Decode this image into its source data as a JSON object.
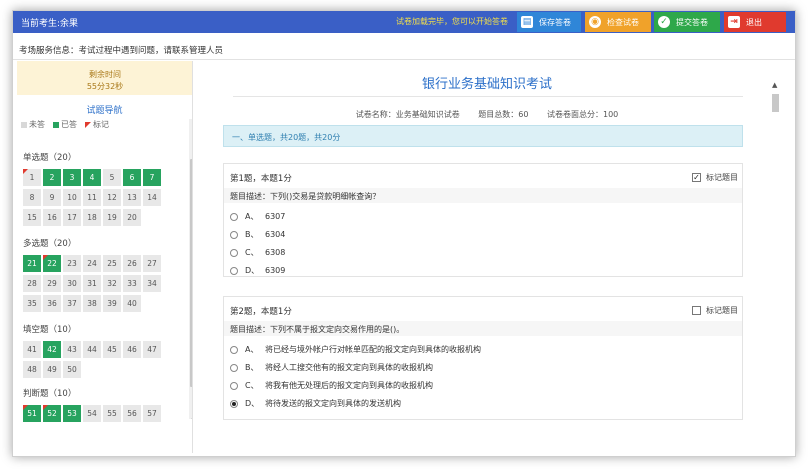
{
  "header": {
    "candidate": "当前考生:余果",
    "load_message": "试卷加载完毕，您可以开始答卷",
    "buttons": {
      "save": "保存答卷",
      "check": "检查试卷",
      "submit": "提交答卷",
      "exit": "退出"
    }
  },
  "notice": "考场服务信息：考试过程中遇到问题，请联系管理人员",
  "sidebar": {
    "timer_label": "剩余时间",
    "timer_value": "55分32秒",
    "nav_title": "试题导航",
    "legend": {
      "unanswered": "未答",
      "answered": "已答",
      "flagged": "标记"
    },
    "sections": [
      {
        "title": "单选题（20）",
        "cells": [
          {
            "n": "1",
            "done": false,
            "flag": true
          },
          {
            "n": "2",
            "done": true,
            "flag": false
          },
          {
            "n": "3",
            "done": true,
            "flag": false
          },
          {
            "n": "4",
            "done": true,
            "flag": false
          },
          {
            "n": "5",
            "done": false,
            "flag": false
          },
          {
            "n": "6",
            "done": true,
            "flag": false
          },
          {
            "n": "7",
            "done": true,
            "flag": false
          },
          {
            "n": "8",
            "done": false,
            "flag": false
          },
          {
            "n": "9",
            "done": false,
            "flag": false
          },
          {
            "n": "10",
            "done": false,
            "flag": false
          },
          {
            "n": "11",
            "done": false,
            "flag": false
          },
          {
            "n": "12",
            "done": false,
            "flag": false
          },
          {
            "n": "13",
            "done": false,
            "flag": false
          },
          {
            "n": "14",
            "done": false,
            "flag": false
          },
          {
            "n": "15",
            "done": false,
            "flag": false
          },
          {
            "n": "16",
            "done": false,
            "flag": false
          },
          {
            "n": "17",
            "done": false,
            "flag": false
          },
          {
            "n": "18",
            "done": false,
            "flag": false
          },
          {
            "n": "19",
            "done": false,
            "flag": false
          },
          {
            "n": "20",
            "done": false,
            "flag": false
          }
        ]
      },
      {
        "title": "多选题（20）",
        "cells": [
          {
            "n": "21",
            "done": true,
            "flag": false
          },
          {
            "n": "22",
            "done": true,
            "flag": true
          },
          {
            "n": "23",
            "done": false,
            "flag": false
          },
          {
            "n": "24",
            "done": false,
            "flag": false
          },
          {
            "n": "25",
            "done": false,
            "flag": false
          },
          {
            "n": "26",
            "done": false,
            "flag": false
          },
          {
            "n": "27",
            "done": false,
            "flag": false
          },
          {
            "n": "28",
            "done": false,
            "flag": false
          },
          {
            "n": "29",
            "done": false,
            "flag": false
          },
          {
            "n": "30",
            "done": false,
            "flag": false
          },
          {
            "n": "31",
            "done": false,
            "flag": false
          },
          {
            "n": "32",
            "done": false,
            "flag": false
          },
          {
            "n": "33",
            "done": false,
            "flag": false
          },
          {
            "n": "34",
            "done": false,
            "flag": false
          },
          {
            "n": "35",
            "done": false,
            "flag": false
          },
          {
            "n": "36",
            "done": false,
            "flag": false
          },
          {
            "n": "37",
            "done": false,
            "flag": false
          },
          {
            "n": "38",
            "done": false,
            "flag": false
          },
          {
            "n": "39",
            "done": false,
            "flag": false
          },
          {
            "n": "40",
            "done": false,
            "flag": false
          }
        ]
      },
      {
        "title": "填空题（10）",
        "cells": [
          {
            "n": "41",
            "done": false,
            "flag": false
          },
          {
            "n": "42",
            "done": true,
            "flag": false
          },
          {
            "n": "43",
            "done": false,
            "flag": false
          },
          {
            "n": "44",
            "done": false,
            "flag": false
          },
          {
            "n": "45",
            "done": false,
            "flag": false
          },
          {
            "n": "46",
            "done": false,
            "flag": false
          },
          {
            "n": "47",
            "done": false,
            "flag": false
          },
          {
            "n": "48",
            "done": false,
            "flag": false
          },
          {
            "n": "49",
            "done": false,
            "flag": false
          },
          {
            "n": "50",
            "done": false,
            "flag": false
          }
        ]
      },
      {
        "title": "判断题（10）",
        "cells": [
          {
            "n": "51",
            "done": true,
            "flag": true
          },
          {
            "n": "52",
            "done": true,
            "flag": true
          },
          {
            "n": "53",
            "done": true,
            "flag": false
          },
          {
            "n": "54",
            "done": false,
            "flag": false
          },
          {
            "n": "55",
            "done": false,
            "flag": false
          },
          {
            "n": "56",
            "done": false,
            "flag": false
          },
          {
            "n": "57",
            "done": false,
            "flag": false
          }
        ]
      }
    ]
  },
  "main": {
    "title": "银行业务基础知识考试",
    "meta": {
      "name": "试卷名称：业务基础知识试卷",
      "count": "题目总数：60",
      "total": "试卷卷面总分：100"
    },
    "section_bar": "一、单选题，共20题，共20分",
    "questions": [
      {
        "head": "第1题，本题1分",
        "mark_label": "标记题目",
        "marked": true,
        "desc": "题目描述：下列()交易是贷款明细帐查询？",
        "options": [
          {
            "letter": "A、",
            "text": "6307",
            "selected": false
          },
          {
            "letter": "B、",
            "text": "6304",
            "selected": false
          },
          {
            "letter": "C、",
            "text": "6308",
            "selected": false
          },
          {
            "letter": "D、",
            "text": "6309",
            "selected": false
          }
        ]
      },
      {
        "head": "第2题，本题1分",
        "mark_label": "标记题目",
        "marked": false,
        "desc": "题目描述：下列不属于报文定向交易作用的是()。",
        "options": [
          {
            "letter": "A、",
            "text": "将已经与境外帐户行对帐单匹配的报文定向到具体的收报机构",
            "selected": false
          },
          {
            "letter": "B、",
            "text": "将经人工搜交他有的报文定向到具体的收报机构",
            "selected": false
          },
          {
            "letter": "C、",
            "text": "将我有他无处理后的报文定向到具体的收报机构",
            "selected": false
          },
          {
            "letter": "D、",
            "text": "将待发送的报文定向到具体的发送机构",
            "selected": true
          }
        ]
      }
    ]
  }
}
